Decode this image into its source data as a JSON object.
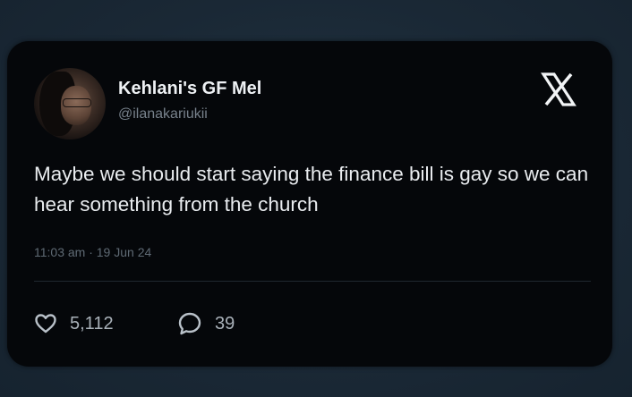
{
  "tweet": {
    "author_name": "Kehlani's GF Mel",
    "handle": "@ilanakariukii",
    "text": "Maybe we should start saying the finance bill is gay so we can hear something from the church",
    "timestamp": "11:03 am · 19 Jun 24",
    "likes": "5,112",
    "replies": "39"
  },
  "icons": {
    "logo": "x-logo-icon",
    "like": "heart-icon",
    "reply": "speech-bubble-icon"
  },
  "colors": {
    "background": "#1b2a37",
    "card": "#05070a",
    "text": "#e9ecef",
    "muted": "#77818b"
  }
}
